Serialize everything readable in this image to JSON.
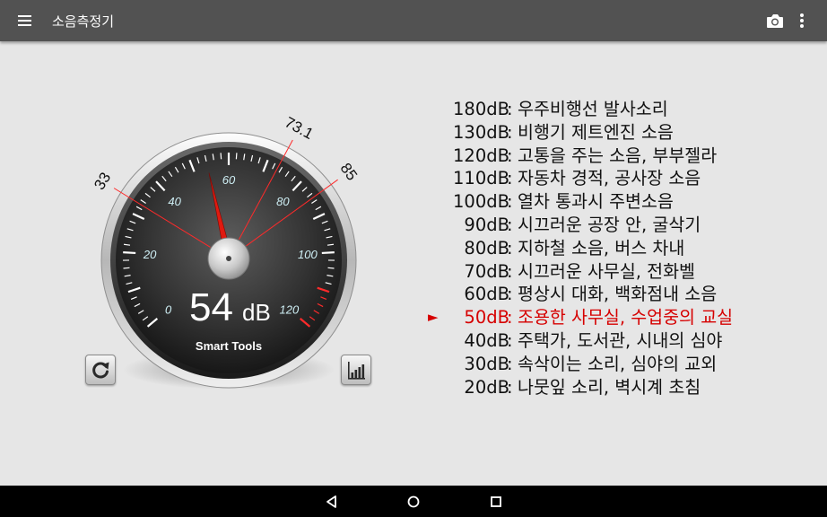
{
  "app": {
    "title": "소음측정기",
    "icons": {
      "menu": "menu-icon",
      "camera": "camera-icon",
      "more": "more-vert-icon"
    }
  },
  "gauge": {
    "reading": "54",
    "unit": "dB",
    "brand": "Smart Tools",
    "needle_value": 54,
    "min_marker": "33",
    "avg_marker": "73.1",
    "max_marker": "85",
    "scale_labels": [
      "0",
      "20",
      "40",
      "60",
      "80",
      "100",
      "120"
    ],
    "scale_min": 0,
    "scale_max": 120,
    "colors": {
      "needle": "#e01a10",
      "marker_line": "#ff2a2a",
      "label": "#cfeff5"
    }
  },
  "buttons": {
    "reset_icon": "refresh-icon",
    "graph_icon": "bar-chart-icon"
  },
  "levels": [
    {
      "db": "180dB",
      "desc": "우주비행선 발사소리"
    },
    {
      "db": "130dB",
      "desc": "비행기 제트엔진 소음"
    },
    {
      "db": "120dB",
      "desc": "고통을 주는 소음, 부부젤라"
    },
    {
      "db": "110dB",
      "desc": "자동차 경적, 공사장 소음"
    },
    {
      "db": "100dB",
      "desc": "열차 통과시 주변소음"
    },
    {
      "db": "90dB",
      "desc": "시끄러운 공장 안, 굴삭기"
    },
    {
      "db": "80dB",
      "desc": "지하철 소음, 버스 차내"
    },
    {
      "db": "70dB",
      "desc": "시끄러운 사무실, 전화벨"
    },
    {
      "db": "60dB",
      "desc": "평상시 대화, 백화점내 소음"
    },
    {
      "db": "50dB",
      "desc": "조용한 사무실, 수업중의 교실",
      "active": true,
      "marker": "►"
    },
    {
      "db": "40dB",
      "desc": "주택가, 도서관, 시내의 심야"
    },
    {
      "db": "30dB",
      "desc": "속삭이는 소리, 심야의 교외"
    },
    {
      "db": "20dB",
      "desc": "나뭇잎 소리, 벽시계 초침"
    }
  ],
  "levels_separator": ":",
  "active_color": "#d60000",
  "navbar": {
    "icons": [
      "back-icon",
      "home-icon",
      "recents-icon"
    ]
  }
}
